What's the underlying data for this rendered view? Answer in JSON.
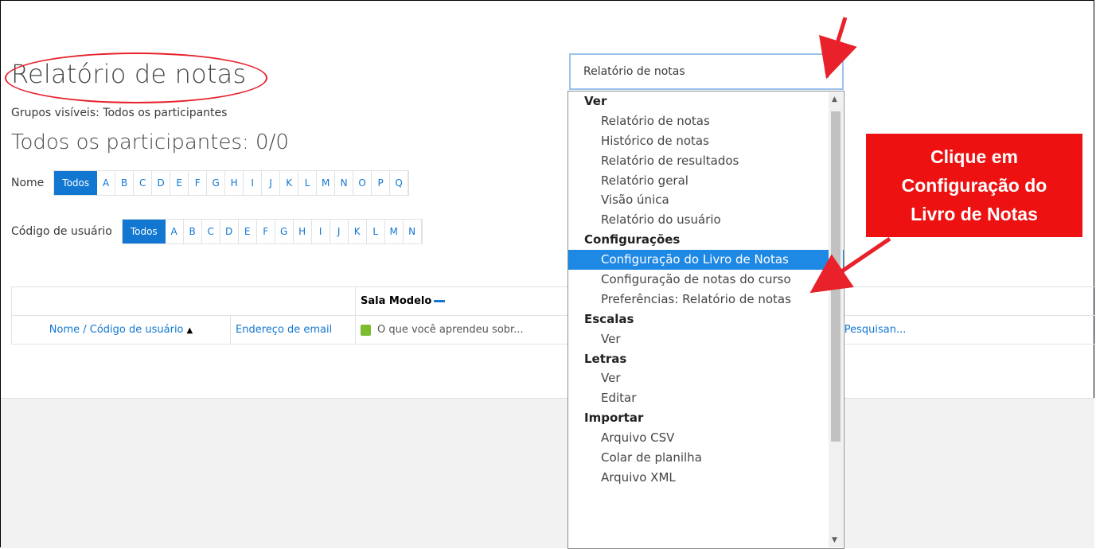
{
  "page": {
    "title": "Relatório de notas",
    "groups_label": "Grupos visíveis: Todos os participantes",
    "participants_heading": "Todos os participantes: 0/0"
  },
  "filters": {
    "name_label": "Nome",
    "user_code_label": "Código de usuário",
    "all_label": "Todos",
    "name_letters": [
      "A",
      "B",
      "C",
      "D",
      "E",
      "F",
      "G",
      "H",
      "I",
      "J",
      "K",
      "L",
      "M",
      "N",
      "O",
      "P",
      "Q"
    ],
    "code_letters": [
      "A",
      "B",
      "C",
      "D",
      "E",
      "F",
      "G",
      "H",
      "I",
      "J",
      "K",
      "L",
      "M",
      "N"
    ]
  },
  "table": {
    "course_header": "Sala Modelo",
    "col_name": "Nome / Código de usuário",
    "col_email": "Endereço de email",
    "col_quiz": "O que você aprendeu sobr...",
    "col_assign": "Tarefa on-line - Pesquisan..."
  },
  "report_select": {
    "value": "Relatório de notas"
  },
  "dropdown": {
    "items": [
      {
        "label": "Ver",
        "type": "group"
      },
      {
        "label": "Relatório de notas",
        "type": "opt"
      },
      {
        "label": "Histórico de notas",
        "type": "opt"
      },
      {
        "label": "Relatório de resultados",
        "type": "opt"
      },
      {
        "label": "Relatório geral",
        "type": "opt"
      },
      {
        "label": "Visão única",
        "type": "opt"
      },
      {
        "label": "Relatório do usuário",
        "type": "opt"
      },
      {
        "label": "Configurações",
        "type": "group"
      },
      {
        "label": "Configuração do Livro de Notas",
        "type": "opt",
        "selected": true
      },
      {
        "label": "Configuração de notas do curso",
        "type": "opt"
      },
      {
        "label": "Preferências: Relatório de notas",
        "type": "opt"
      },
      {
        "label": "Escalas",
        "type": "group"
      },
      {
        "label": "Ver",
        "type": "opt"
      },
      {
        "label": "Letras",
        "type": "group"
      },
      {
        "label": "Ver",
        "type": "opt"
      },
      {
        "label": "Editar",
        "type": "opt"
      },
      {
        "label": "Importar",
        "type": "group"
      },
      {
        "label": "Arquivo CSV",
        "type": "opt"
      },
      {
        "label": "Colar de planilha",
        "type": "opt"
      },
      {
        "label": "Arquivo XML",
        "type": "opt"
      }
    ]
  },
  "callout": {
    "lines": [
      "Clique em",
      "Configuração do",
      "Livro de Notas"
    ]
  },
  "colors": {
    "accent": "#1177d1",
    "annotation_red": "#ee1111",
    "selected_option": "#1e88e5"
  },
  "icons": [
    "quiz-icon",
    "assignment-icon",
    "sort-up-icon",
    "collapse-icon",
    "edit-icon",
    "dropdown-arrow-icon"
  ]
}
